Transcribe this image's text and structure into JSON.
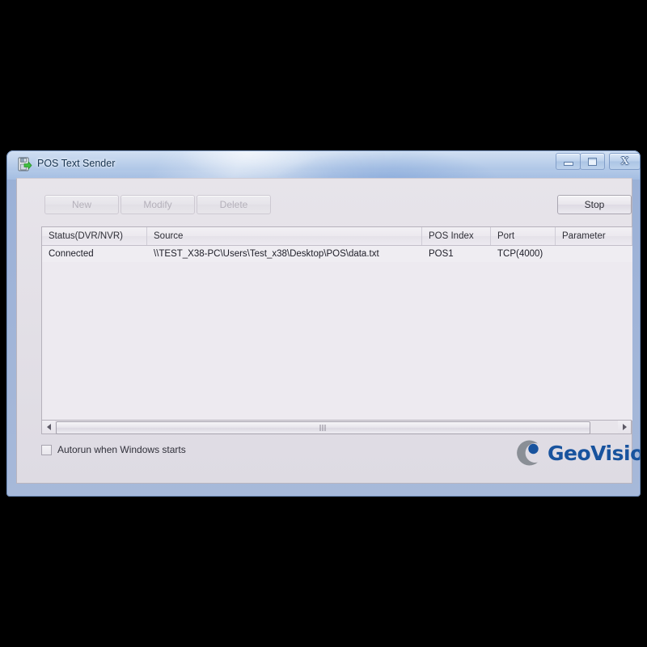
{
  "window": {
    "title": "POS Text Sender",
    "icon": "save-export-green-icon",
    "controls": {
      "minimize": "minimize-button",
      "maximize": "maximize-button",
      "close": "close-button"
    }
  },
  "toolbar": {
    "new_label": "New",
    "modify_label": "Modify",
    "delete_label": "Delete",
    "stop_label": "Stop",
    "new_enabled": false,
    "modify_enabled": false,
    "delete_enabled": false,
    "stop_enabled": true
  },
  "listview": {
    "columns": [
      "Status(DVR/NVR)",
      "Source",
      "POS Index",
      "Port",
      "Parameter"
    ],
    "rows": [
      {
        "status": "Connected",
        "source": "\\\\TEST_X38-PC\\Users\\Test_x38\\Desktop\\POS\\data.txt",
        "pos_index": "POS1",
        "port": "TCP(4000)",
        "parameter": ""
      }
    ]
  },
  "scrollbar": {
    "orientation": "horizontal",
    "left_arrow": "scroll-left-arrow",
    "right_arrow": "scroll-right-arrow",
    "thumb": "scroll-thumb"
  },
  "options": {
    "autorun_label": "Autorun when Windows starts",
    "autorun_checked": false
  },
  "branding": {
    "name": "GeoVision",
    "text_color": "#18539e",
    "mark_color": "#8a8f96"
  }
}
